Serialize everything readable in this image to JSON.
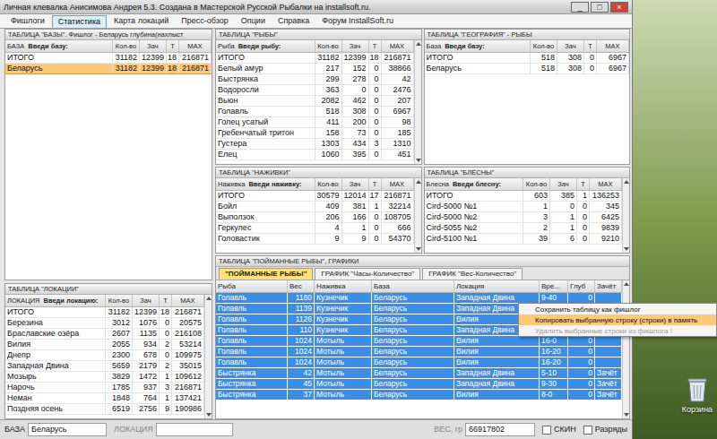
{
  "window": {
    "title": "Личная клевалка Анисимова Андрея 5.3. Создана в Мастерской Русской Рыбалки на installsoft.ru.",
    "controls": [
      "_",
      "□",
      "×"
    ]
  },
  "tabs": [
    {
      "label": "Фишлоги",
      "selected": false
    },
    {
      "label": "Статистика",
      "selected": true
    },
    {
      "label": "Карта локаций",
      "selected": false
    },
    {
      "label": "Пресс-обзор",
      "selected": false
    },
    {
      "label": "Опции",
      "selected": false
    },
    {
      "label": "Справка",
      "selected": false
    },
    {
      "label": "Форум InstallSoft.ru",
      "selected": false
    }
  ],
  "tables": {
    "bases": {
      "title": "ТАБЛИЦА \"БАЗЫ\". Фишлог - Беларусь глубина(нахлыст",
      "columns": [
        "БАЗА",
        "Кол-во",
        "Зач",
        "Т",
        "MAX"
      ],
      "filter": "Введи базу:",
      "rows": [
        {
          "cells": [
            "ИТОГО",
            "31182",
            "12399",
            "18",
            "216871"
          ],
          "selected": false
        },
        {
          "cells": [
            "Беларусь",
            "31182",
            "12399",
            "18",
            "216871"
          ],
          "selected": true
        }
      ]
    },
    "locations": {
      "title": "ТАБЛИЦА \"ЛОКАЦИИ\"",
      "columns": [
        "ЛОКАЦИЯ",
        "Кол-во",
        "Зач",
        "Т",
        "MAX"
      ],
      "filter": "Введи локацию:",
      "rows": [
        {
          "cells": [
            "ИТОГО",
            "31182",
            "12399",
            "18",
            "216871"
          ],
          "selected": false
        },
        {
          "cells": [
            "Березина",
            "3012",
            "1076",
            "0",
            "20575"
          ],
          "selected": false
        },
        {
          "cells": [
            "Браславские озёра",
            "2607",
            "1135",
            "0",
            "216108"
          ],
          "selected": false
        },
        {
          "cells": [
            "Вилия",
            "2055",
            "934",
            "2",
            "53214"
          ],
          "selected": false
        },
        {
          "cells": [
            "Днепр",
            "2300",
            "678",
            "0",
            "109975"
          ],
          "selected": false
        },
        {
          "cells": [
            "Западная Двина",
            "5659",
            "2179",
            "2",
            "35015"
          ],
          "selected": false
        },
        {
          "cells": [
            "Мозырь",
            "3829",
            "1472",
            "1",
            "109612"
          ],
          "selected": false
        },
        {
          "cells": [
            "Нарочь",
            "1785",
            "937",
            "3",
            "216871"
          ],
          "selected": false
        },
        {
          "cells": [
            "Неман",
            "1848",
            "764",
            "1",
            "137421"
          ],
          "selected": false
        },
        {
          "cells": [
            "Поздняя осень",
            "6519",
            "2756",
            "9",
            "190986"
          ],
          "selected": false
        }
      ]
    },
    "fish": {
      "title": "ТАБЛИЦА \"РЫБЫ\"",
      "columns": [
        "Рыба",
        "Кол-во",
        "Зач",
        "Т",
        "MAX"
      ],
      "filter": "Введи рыбу:",
      "rows": [
        {
          "cells": [
            "ИТОГО",
            "31182",
            "12399",
            "18",
            "216871"
          ],
          "selected": false
        },
        {
          "cells": [
            "Белый амур",
            "217",
            "152",
            "0",
            "38866"
          ],
          "selected": false
        },
        {
          "cells": [
            "Быстрянка",
            "299",
            "278",
            "0",
            "42"
          ],
          "selected": false
        },
        {
          "cells": [
            "Водоросли",
            "363",
            "0",
            "0",
            "2476"
          ],
          "selected": false
        },
        {
          "cells": [
            "Вьюн",
            "2082",
            "462",
            "0",
            "207"
          ],
          "selected": false
        },
        {
          "cells": [
            "Голавль",
            "518",
            "308",
            "0",
            "6967"
          ],
          "selected": false
        },
        {
          "cells": [
            "Голец усатый",
            "411",
            "200",
            "0",
            "98"
          ],
          "selected": false
        },
        {
          "cells": [
            "Гребенчатый тритон",
            "158",
            "73",
            "0",
            "185"
          ],
          "selected": false
        },
        {
          "cells": [
            "Густера",
            "1303",
            "434",
            "3",
            "1310"
          ],
          "selected": false
        },
        {
          "cells": [
            "Елец",
            "1060",
            "395",
            "0",
            "451"
          ],
          "selected": false
        }
      ]
    },
    "geography": {
      "title": "ТАБЛИЦА \"ГЕОГРАФИЯ\" - РЫБЫ",
      "columns": [
        "База",
        "Кол-во",
        "Зач",
        "Т",
        "MAX"
      ],
      "filter": "Введи базу:",
      "rows": [
        {
          "cells": [
            "ИТОГО",
            "518",
            "308",
            "0",
            "6967"
          ],
          "selected": false
        },
        {
          "cells": [
            "Беларусь",
            "518",
            "308",
            "0",
            "6967"
          ],
          "selected": false
        }
      ]
    },
    "baits": {
      "title": "ТАБЛИЦА \"НАЖИВКИ\"",
      "columns": [
        "Наживка",
        "Кол-во",
        "Зач",
        "Т",
        "MAX"
      ],
      "filter": "Введи наживку:",
      "rows": [
        {
          "cells": [
            "ИТОГО",
            "30579",
            "12014",
            "17",
            "216871"
          ],
          "selected": false
        },
        {
          "cells": [
            "Бойл",
            "409",
            "381",
            "1",
            "32214"
          ],
          "selected": false
        },
        {
          "cells": [
            "Выползок",
            "206",
            "166",
            "0",
            "108705"
          ],
          "selected": false
        },
        {
          "cells": [
            "Геркулес",
            "4",
            "1",
            "0",
            "666"
          ],
          "selected": false
        },
        {
          "cells": [
            "Головастик",
            "9",
            "9",
            "0",
            "54370"
          ],
          "selected": false
        }
      ]
    },
    "lures": {
      "title": "ТАБЛИЦА \"БЛЁСНЫ\"",
      "columns": [
        "Блесна",
        "Кол-во",
        "Зач",
        "Т",
        "MAX"
      ],
      "filter": "Введи блесну:",
      "rows": [
        {
          "cells": [
            "ИТОГО",
            "603",
            "385",
            "1",
            "136253"
          ],
          "selected": false
        },
        {
          "cells": [
            "Cird-5000 №1",
            "1",
            "0",
            "0",
            "345"
          ],
          "selected": false
        },
        {
          "cells": [
            "Cird-5000 №2",
            "3",
            "1",
            "0",
            "6425"
          ],
          "selected": false
        },
        {
          "cells": [
            "Cird-5055 №2",
            "2",
            "1",
            "0",
            "9839"
          ],
          "selected": false
        },
        {
          "cells": [
            "Cird-5100 №1",
            "39",
            "6",
            "0",
            "9210"
          ],
          "selected": false
        }
      ]
    }
  },
  "catches": {
    "title": "ТАБЛИЦА \"ПОЙМАННЫЕ РЫБЫ\", ГРАФИКИ",
    "subtabs": [
      {
        "label": "\"ПОЙМАННЫЕ РЫБЫ\"",
        "selected": true
      },
      {
        "label": "ГРАФИК \"Часы-Количество\"",
        "selected": false
      },
      {
        "label": "ГРАФИК \"Вес-Количество\"",
        "selected": false
      }
    ],
    "columns": [
      "Рыба",
      "Вес",
      "Наживка",
      "База",
      "Локация",
      "Вре...",
      "Глуб",
      "Зачёт"
    ],
    "rows": [
      {
        "cells": [
          "Голавль",
          "1180",
          "Кузнечик",
          "Беларусь",
          "Западная Двина",
          "9-40",
          "0",
          ""
        ],
        "selected": true
      },
      {
        "cells": [
          "Голавль",
          "1139",
          "Кузнечик",
          "Беларусь",
          "Западная Двина",
          "",
          "",
          ""
        ],
        "selected": true
      },
      {
        "cells": [
          "Голавль",
          "1126",
          "Кузнечик",
          "Беларусь",
          "Вилия",
          "",
          "",
          ""
        ],
        "selected": true
      },
      {
        "cells": [
          "Голавль",
          "110",
          "Кузнечик",
          "Беларусь",
          "Западная Двина",
          "",
          "",
          ""
        ],
        "selected": true
      },
      {
        "cells": [
          "Голавль",
          "1024",
          "Мотыль",
          "Беларусь",
          "Вилия",
          "16-0",
          "0",
          ""
        ],
        "selected": true
      },
      {
        "cells": [
          "Голавль",
          "1024",
          "Мотыль",
          "Беларусь",
          "Вилия",
          "16-20",
          "0",
          ""
        ],
        "selected": true
      },
      {
        "cells": [
          "Голавль",
          "1024",
          "Мотыль",
          "Беларусь",
          "Вилия",
          "16-20",
          "0",
          ""
        ],
        "selected": true
      },
      {
        "cells": [
          "Быстрянка",
          "42",
          "Мотыль",
          "Беларусь",
          "Западная Двина",
          "5-10",
          "0",
          "Зачёт"
        ],
        "selected": true
      },
      {
        "cells": [
          "Быстрянка",
          "45",
          "Мотыль",
          "Беларусь",
          "Западная Двина",
          "9-30",
          "0",
          "Зачёт"
        ],
        "selected": true
      },
      {
        "cells": [
          "Быстрянка",
          "37",
          "Мотыль",
          "Беларусь",
          "Вилия",
          "8-0",
          "0",
          "Зачёт"
        ],
        "selected": true
      }
    ]
  },
  "context_menu": {
    "items": [
      {
        "label": "Сохранить таблицу как фишлог",
        "highlighted": false,
        "disabled": false
      },
      {
        "label": "Копировать выбранную строку (строки) в память",
        "highlighted": true,
        "disabled": false
      },
      {
        "label": "Удалить выбранные строки из фишлога !",
        "highlighted": false,
        "disabled": true
      }
    ]
  },
  "status_bar": {
    "base": {
      "label": "БАЗА",
      "value": "Беларусь",
      "disabled": false
    },
    "location": {
      "label": "ЛОКАЦИЯ",
      "value": "",
      "disabled": true
    },
    "weight": {
      "label": "ВЕС, гр",
      "value": "66917802",
      "disabled": true
    },
    "checkboxes": [
      {
        "label": "СКИН",
        "checked": false
      },
      {
        "label": "Разряды",
        "checked": false
      }
    ]
  },
  "desktop": {
    "icons": [
      {
        "label": "Корзина"
      }
    ]
  }
}
